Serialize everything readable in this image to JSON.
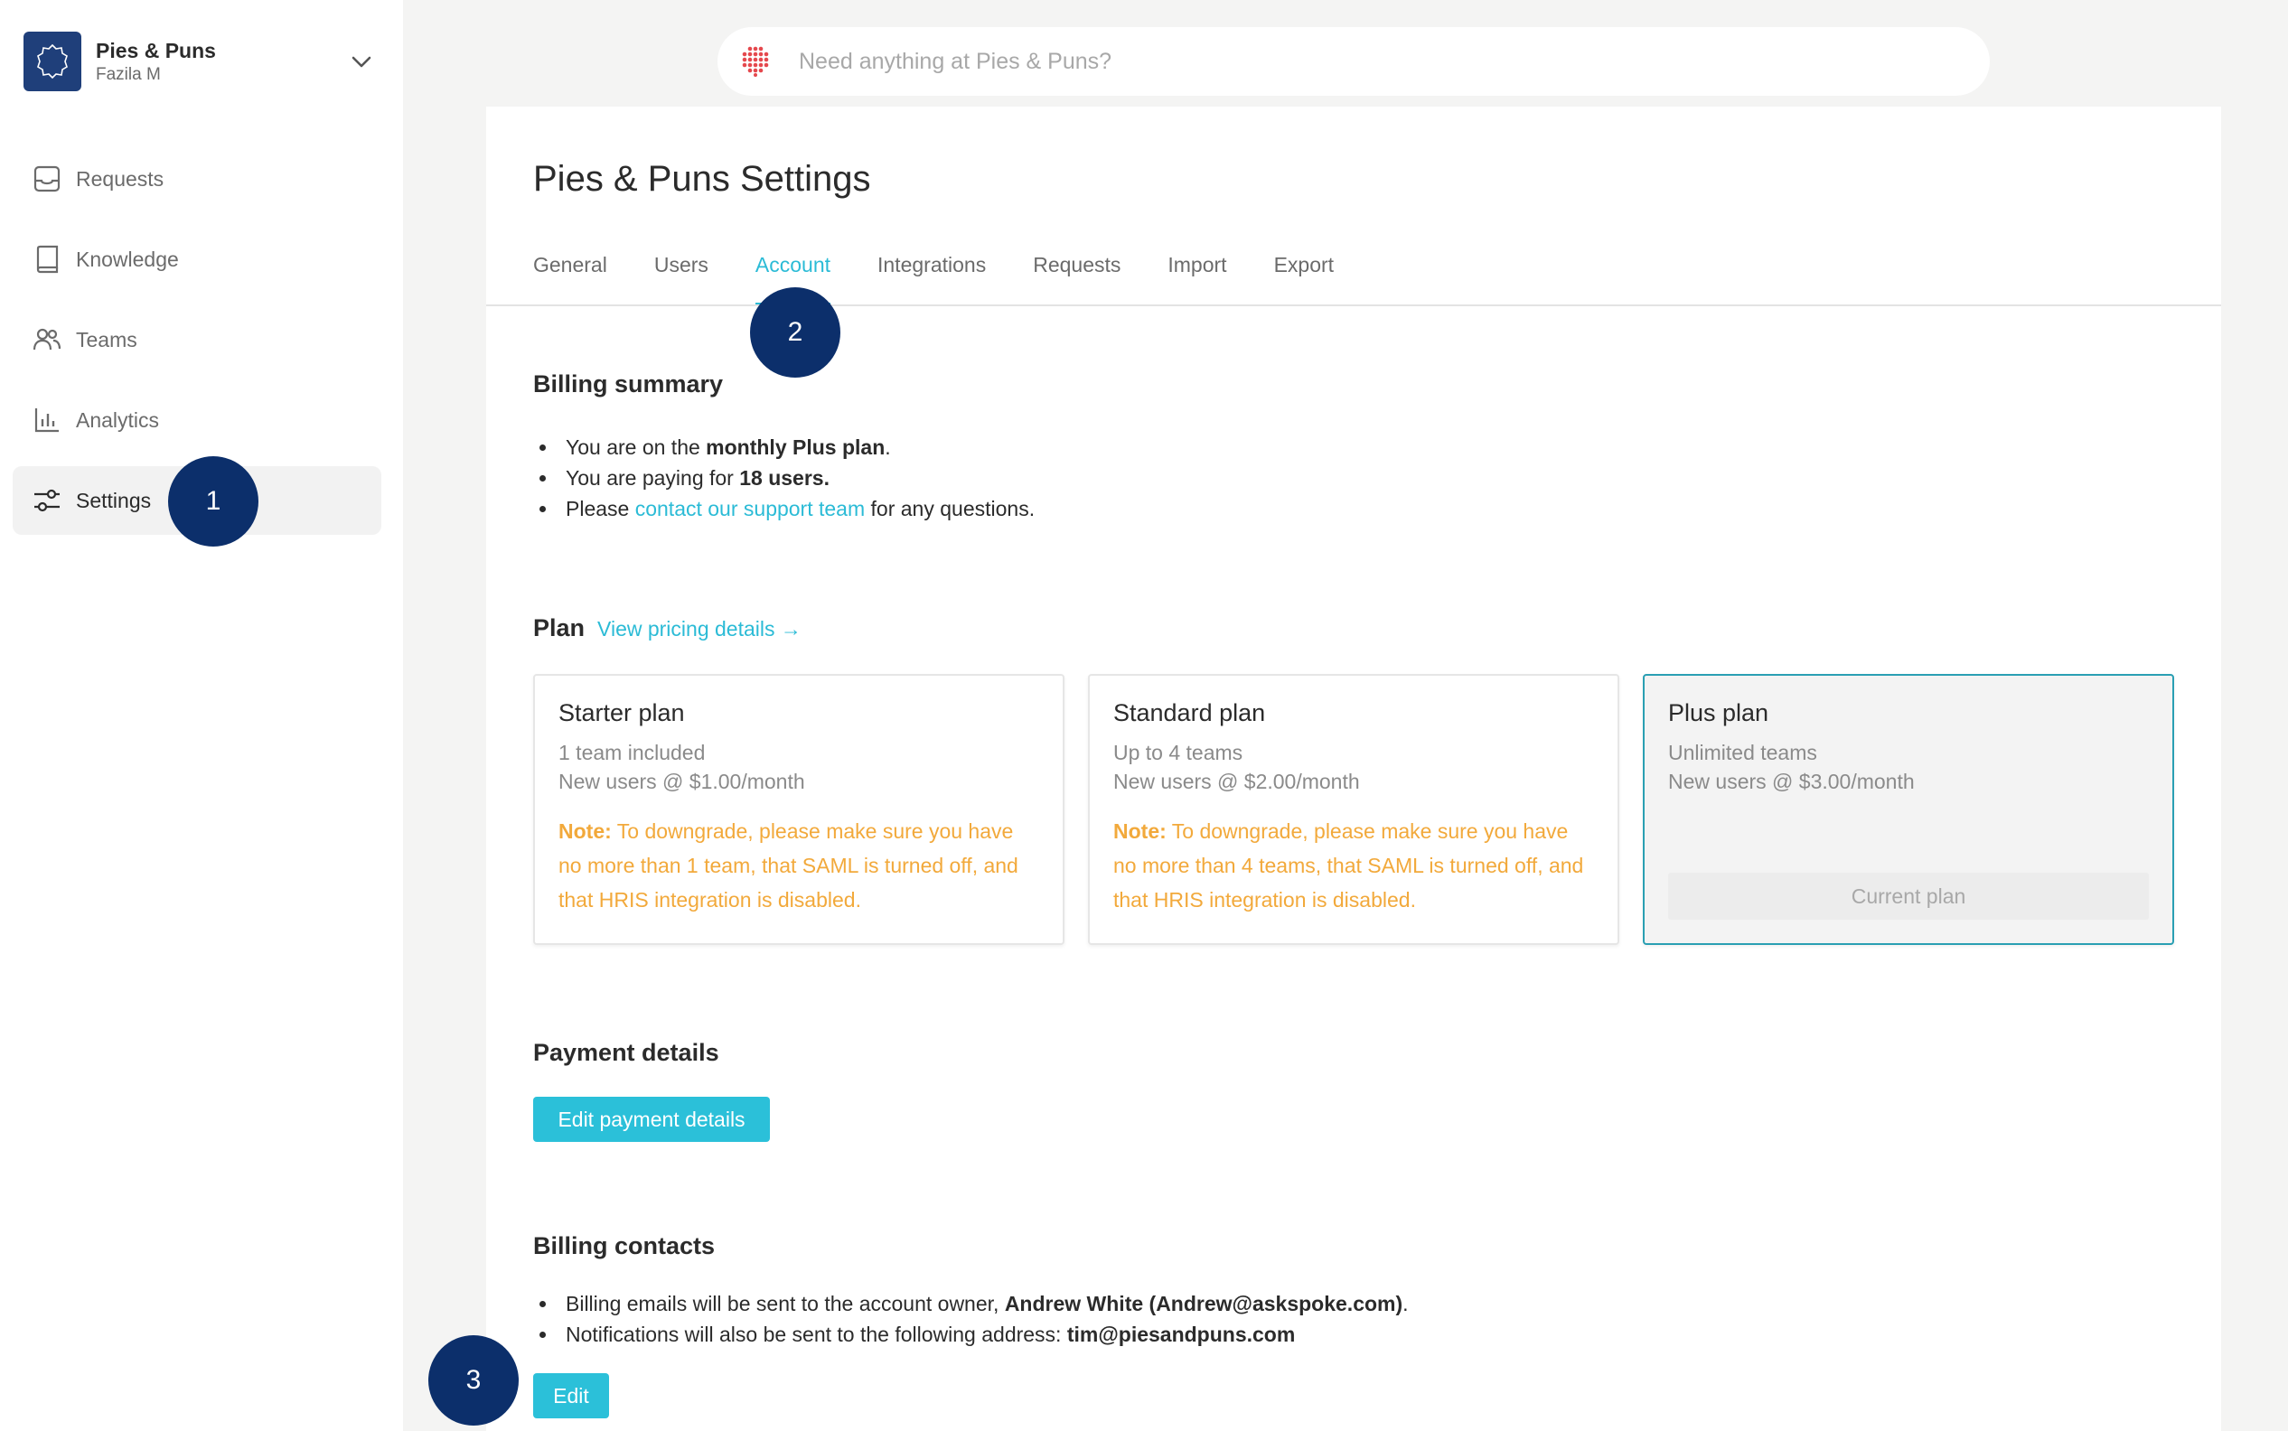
{
  "org": {
    "name": "Pies & Puns",
    "user": "Fazila M"
  },
  "sidebar": {
    "items": [
      {
        "label": "Requests"
      },
      {
        "label": "Knowledge"
      },
      {
        "label": "Teams"
      },
      {
        "label": "Analytics"
      },
      {
        "label": "Settings"
      }
    ]
  },
  "markers": [
    "1",
    "2",
    "3"
  ],
  "search": {
    "placeholder": "Need anything at Pies & Puns?"
  },
  "page": {
    "title": "Pies & Puns Settings"
  },
  "tabs": [
    {
      "label": "General"
    },
    {
      "label": "Users"
    },
    {
      "label": "Account"
    },
    {
      "label": "Integrations"
    },
    {
      "label": "Requests"
    },
    {
      "label": "Import"
    },
    {
      "label": "Export"
    }
  ],
  "billing_summary": {
    "title": "Billing summary",
    "line1_pre": "You are on the ",
    "line1_bold": "monthly Plus plan",
    "line1_post": ".",
    "line2_pre": "You are paying for ",
    "line2_bold": "18 users.",
    "line3_pre": "Please ",
    "line3_link": "contact our support team",
    "line3_post": " for any questions."
  },
  "plan": {
    "title": "Plan",
    "pricing_link": "View pricing details →",
    "cards": [
      {
        "name": "Starter plan",
        "line1": "1 team included",
        "line2": "New users @ $1.00/month",
        "note_label": "Note:",
        "note_text": " To downgrade, please make sure you have no more than 1 team, that SAML is turned off, and that HRIS integration is disabled."
      },
      {
        "name": "Standard plan",
        "line1": "Up to 4 teams",
        "line2": "New users @ $2.00/month",
        "note_label": "Note:",
        "note_text": " To downgrade, please make sure you have no more than 4 teams, that SAML is turned off, and that HRIS integration is disabled."
      },
      {
        "name": "Plus plan",
        "line1": "Unlimited teams",
        "line2": "New users @ $3.00/month",
        "current_label": "Current plan"
      }
    ]
  },
  "payment": {
    "title": "Payment details",
    "button": "Edit payment details"
  },
  "billing_contacts": {
    "title": "Billing contacts",
    "line1_pre": "Billing emails will be sent to the account owner, ",
    "line1_bold": "Andrew White (Andrew@askspoke.com)",
    "line1_post": ".",
    "line2_pre": "Notifications will also be sent to the following address: ",
    "line2_bold": "tim@piesandpuns.com",
    "edit_button": "Edit"
  },
  "colors": {
    "accent": "#2bbbd6",
    "marker": "#0c2f6b",
    "note": "#f2a93b",
    "logo": "#1f3f7a"
  }
}
